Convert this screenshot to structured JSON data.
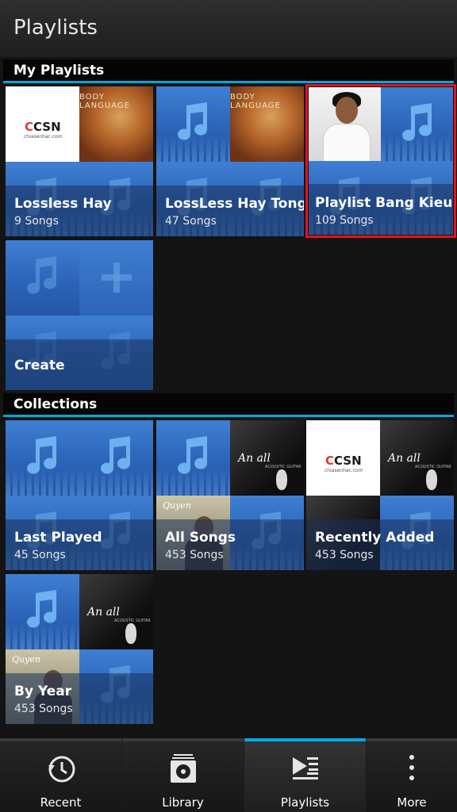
{
  "header": {
    "title": "Playlists"
  },
  "sections": {
    "my_playlists": "My Playlists",
    "collections": "Collections"
  },
  "my_playlists": [
    {
      "title": "Lossless Hay",
      "subtitle": "9 Songs"
    },
    {
      "title": "LossLess Hay Tong",
      "subtitle": "47 Songs"
    },
    {
      "title": "Playlist Bang Kieu",
      "subtitle": "109 Songs",
      "selected": true
    },
    {
      "title": "Create",
      "subtitle": ""
    }
  ],
  "collections": [
    {
      "title": "Last Played",
      "subtitle": "45 Songs"
    },
    {
      "title": "All Songs",
      "subtitle": "453 Songs"
    },
    {
      "title": "Recently Added",
      "subtitle": "453 Songs"
    },
    {
      "title": "By Year",
      "subtitle": "453 Songs"
    }
  ],
  "artwork_text": {
    "csn_logo_main": "CSN",
    "csn_logo_url": "chiasenhac.com",
    "body_language": "BODY LANGUAGE",
    "an_album": "An all",
    "an_album_sub": "ACOUSTIC GUITAR",
    "signature": "Quyen"
  },
  "tabs": [
    {
      "label": "Recent",
      "icon": "clock-history-icon"
    },
    {
      "label": "Library",
      "icon": "library-disc-icon"
    },
    {
      "label": "Playlists",
      "icon": "playlist-icon",
      "active": true
    },
    {
      "label": "More",
      "icon": "more-vertical-icon"
    }
  ],
  "colors": {
    "accent": "#00a8df",
    "selection": "#e0141d",
    "tile_blue": "#2c64b8"
  }
}
